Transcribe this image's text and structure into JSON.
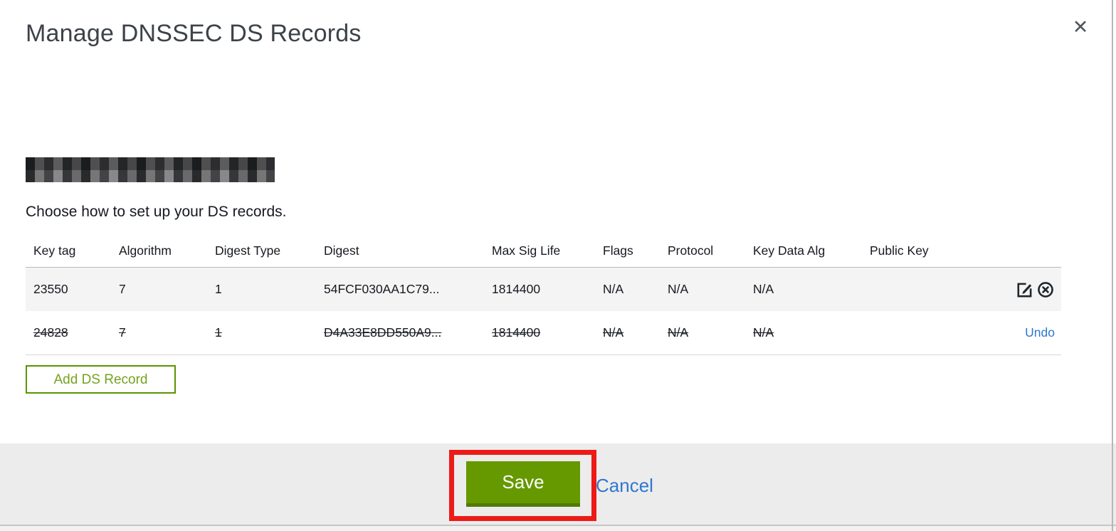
{
  "dialog": {
    "title": "Manage DNSSEC DS Records",
    "close_glyph": "✕",
    "subtitle": "Choose how to set up your DS records.",
    "domain": {
      "redacted": true
    }
  },
  "table": {
    "headers": [
      "Key tag",
      "Algorithm",
      "Digest Type",
      "Digest",
      "Max Sig Life",
      "Flags",
      "Protocol",
      "Key Data Alg",
      "Public Key"
    ],
    "rows": [
      {
        "key_tag": "23550",
        "algorithm": "7",
        "digest_type": "1",
        "digest": "54FCF030AA1C79...",
        "max_sig_life": "1814400",
        "flags": "N/A",
        "protocol": "N/A",
        "key_data_alg": "N/A",
        "public_key": "",
        "state": "current"
      },
      {
        "key_tag": "24828",
        "algorithm": "7",
        "digest_type": "1",
        "digest": "D4A33E8DD550A9...",
        "max_sig_life": "1814400",
        "flags": "N/A",
        "protocol": "N/A",
        "key_data_alg": "N/A",
        "public_key": "",
        "state": "deleted",
        "action_label": "Undo"
      }
    ]
  },
  "buttons": {
    "add_ds_record": "Add DS Record",
    "save": "Save",
    "cancel": "Cancel"
  },
  "icons": {
    "edit": "edit-icon",
    "remove": "remove-icon",
    "close": "close-icon"
  },
  "colors": {
    "save_green": "#669900",
    "save_green_dark": "#527a00",
    "add_border_green": "#5a9400",
    "add_text_green": "#76a21e",
    "link_blue": "#2e77d0",
    "annotation_red": "#ec1b17",
    "row_highlight": "#f4f4f4",
    "footer_gray": "#ececec"
  }
}
